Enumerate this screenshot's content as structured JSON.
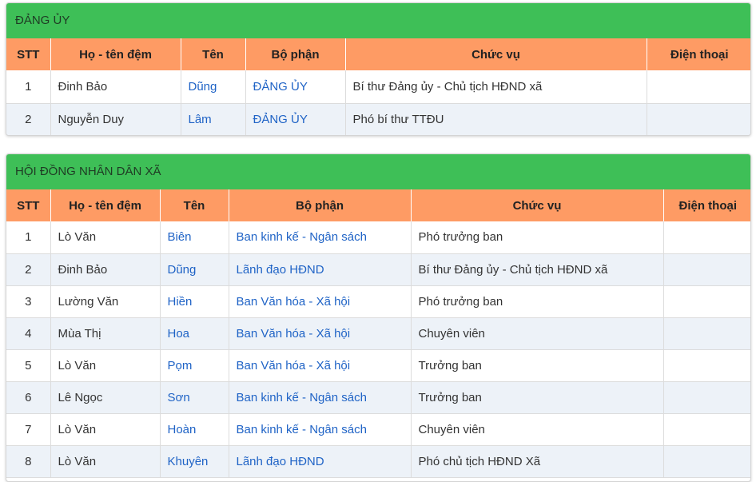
{
  "columns": {
    "stt": "STT",
    "ho_ten_dem": "Họ - tên đệm",
    "ten": "Tên",
    "bo_phan": "Bộ phận",
    "chuc_vu": "Chức vụ",
    "dien_thoai": "Điện thoại"
  },
  "sections": [
    {
      "title": "ĐẢNG ỦY",
      "rows": [
        {
          "stt": "1",
          "ho_ten_dem": "Đinh Bảo",
          "ten": "Dũng",
          "bo_phan": "ĐẢNG ỦY",
          "chuc_vu": "Bí thư Đảng ủy - Chủ tịch HĐND xã",
          "dien_thoai": ""
        },
        {
          "stt": "2",
          "ho_ten_dem": "Nguyễn Duy",
          "ten": "Lâm",
          "bo_phan": "ĐẢNG ỦY",
          "chuc_vu": "Phó bí thư TTĐU",
          "dien_thoai": ""
        }
      ]
    },
    {
      "title": "HỘI ĐỒNG NHÂN DÂN XÃ",
      "rows": [
        {
          "stt": "1",
          "ho_ten_dem": "Lò Văn",
          "ten": "Biên",
          "bo_phan": "Ban kinh kế - Ngân sách",
          "chuc_vu": "Phó trưởng ban",
          "dien_thoai": ""
        },
        {
          "stt": "2",
          "ho_ten_dem": "Đinh Bảo",
          "ten": "Dũng",
          "bo_phan": "Lãnh đạo HĐND",
          "chuc_vu": "Bí thư Đảng ủy - Chủ tịch HĐND xã",
          "dien_thoai": ""
        },
        {
          "stt": "3",
          "ho_ten_dem": "Lường Văn",
          "ten": "Hiền",
          "bo_phan": "Ban Văn hóa - Xã hội",
          "chuc_vu": "Phó trưởng ban",
          "dien_thoai": ""
        },
        {
          "stt": "4",
          "ho_ten_dem": "Mùa Thị",
          "ten": "Hoa",
          "bo_phan": "Ban Văn hóa - Xã hội",
          "chuc_vu": "Chuyên viên",
          "dien_thoai": ""
        },
        {
          "stt": "5",
          "ho_ten_dem": "Lò Văn",
          "ten": "Pọm",
          "bo_phan": "Ban Văn hóa - Xã hội",
          "chuc_vu": "Trưởng ban",
          "dien_thoai": ""
        },
        {
          "stt": "6",
          "ho_ten_dem": "Lê Ngọc",
          "ten": "Sơn",
          "bo_phan": "Ban kinh kế - Ngân sách",
          "chuc_vu": "Trưởng ban",
          "dien_thoai": ""
        },
        {
          "stt": "7",
          "ho_ten_dem": "Lò Văn",
          "ten": "Hoàn",
          "bo_phan": "Ban kinh kế - Ngân sách",
          "chuc_vu": "Chuyên viên",
          "dien_thoai": ""
        },
        {
          "stt": "8",
          "ho_ten_dem": "Lò Văn",
          "ten": "Khuyên",
          "bo_phan": "Lãnh đạo HĐND",
          "chuc_vu": "Phó chủ tịch HĐND Xã",
          "dien_thoai": ""
        }
      ]
    }
  ]
}
